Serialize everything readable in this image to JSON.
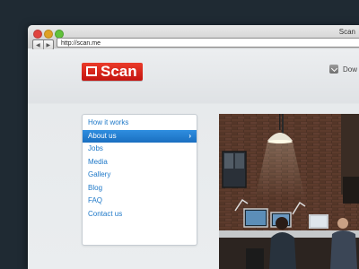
{
  "browser": {
    "window_title": "Scan",
    "url": "http://scan.me",
    "back_label": "◀",
    "forward_label": "▶"
  },
  "header": {
    "logo_text": "Scan",
    "download_label": "Dow"
  },
  "menu": {
    "items": [
      {
        "label": "How it works",
        "active": false
      },
      {
        "label": "About us",
        "active": true
      },
      {
        "label": "Jobs",
        "active": false
      },
      {
        "label": "Media",
        "active": false
      },
      {
        "label": "Gallery",
        "active": false
      },
      {
        "label": "Blog",
        "active": false
      },
      {
        "label": "FAQ",
        "active": false
      },
      {
        "label": "Contact us",
        "active": false
      }
    ],
    "active_chevron": "›"
  },
  "colors": {
    "background": "#1f2a33",
    "logo_red": "#d8261b",
    "menu_link": "#1e78c8",
    "menu_active": "#2580d4"
  },
  "icons": {
    "logo_mark": "scan-bracket-icon",
    "download": "download-icon",
    "chevron": "chevron-right-icon"
  }
}
